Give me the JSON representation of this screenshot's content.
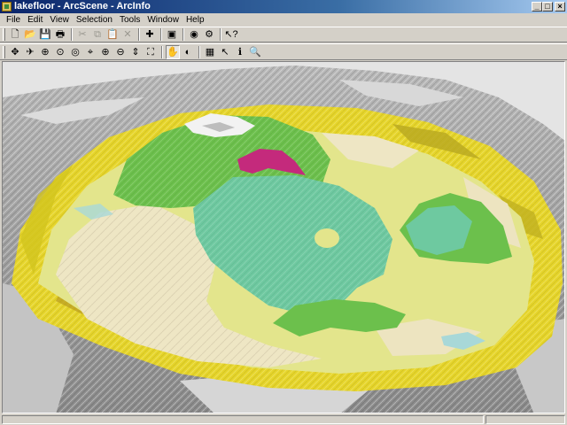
{
  "window": {
    "title": "lakefloor - ArcScene - ArcInfo"
  },
  "window_controls": {
    "minimize": "_",
    "maximize": "□",
    "close": "×"
  },
  "menu": {
    "items": [
      {
        "label": "File"
      },
      {
        "label": "Edit"
      },
      {
        "label": "View"
      },
      {
        "label": "Selection"
      },
      {
        "label": "Tools"
      },
      {
        "label": "Window"
      },
      {
        "label": "Help"
      }
    ]
  },
  "toolbar_standard": {
    "buttons": [
      {
        "name": "new-icon",
        "glyph": "🗋",
        "enabled": true
      },
      {
        "name": "open-icon",
        "glyph": "📂",
        "enabled": true
      },
      {
        "name": "save-icon",
        "glyph": "💾",
        "enabled": true
      },
      {
        "name": "print-icon",
        "glyph": "🖶",
        "enabled": true
      },
      {
        "name": "cut-icon",
        "glyph": "✂",
        "enabled": false
      },
      {
        "name": "copy-icon",
        "glyph": "⧉",
        "enabled": false
      },
      {
        "name": "paste-icon",
        "glyph": "📋",
        "enabled": false
      },
      {
        "name": "delete-icon",
        "glyph": "✕",
        "enabled": false
      },
      {
        "name": "add-data-icon",
        "glyph": "✚",
        "enabled": true
      },
      {
        "name": "scene-properties-icon",
        "glyph": "▣",
        "enabled": true
      },
      {
        "name": "arccatalog-icon",
        "glyph": "◉",
        "enabled": true
      },
      {
        "name": "arctoolbox-icon",
        "glyph": "⚙",
        "enabled": true
      },
      {
        "name": "whats-this-icon",
        "glyph": "↖?",
        "enabled": true
      }
    ]
  },
  "toolbar_tools": {
    "buttons": [
      {
        "name": "navigate-icon",
        "glyph": "✥",
        "pressed": false
      },
      {
        "name": "fly-icon",
        "glyph": "✈",
        "pressed": false
      },
      {
        "name": "target-icon",
        "glyph": "⊕",
        "pressed": false
      },
      {
        "name": "zoom-to-target-icon",
        "glyph": "⊙",
        "pressed": false
      },
      {
        "name": "set-observer-icon",
        "glyph": "◎",
        "pressed": false
      },
      {
        "name": "center-on-target-icon",
        "glyph": "⌖",
        "pressed": false
      },
      {
        "name": "zoom-in-icon",
        "glyph": "⊕",
        "pressed": false
      },
      {
        "name": "zoom-out-icon",
        "glyph": "⊖",
        "pressed": false
      },
      {
        "name": "zoom-in-out-icon",
        "glyph": "⇕",
        "pressed": false
      },
      {
        "name": "full-extent-icon",
        "glyph": "⛶",
        "pressed": false
      },
      {
        "name": "pan-icon",
        "glyph": "✋",
        "pressed": true
      },
      {
        "name": "globe-icon",
        "glyph": "◐",
        "pressed": false
      },
      {
        "name": "select-elements-icon",
        "glyph": "▦",
        "pressed": false
      },
      {
        "name": "select-features-icon",
        "glyph": "↖",
        "pressed": false
      },
      {
        "name": "identify-icon",
        "glyph": "ℹ",
        "pressed": false
      },
      {
        "name": "find-icon",
        "glyph": "🔍",
        "pressed": false
      }
    ]
  },
  "scene": {
    "colors": {
      "background": "#e4e4e4",
      "rim_gray": "#9a9a9a",
      "rim_dark": "#6e6e6e",
      "outer_yellow": "#e8d830",
      "shelf_yellow": "#e3e58c",
      "floor_beige": "#eee6c4",
      "teal": "#6ec9a0",
      "green": "#6cc04c",
      "magenta": "#c42a7c",
      "light_blue": "#a8d8d8"
    }
  }
}
